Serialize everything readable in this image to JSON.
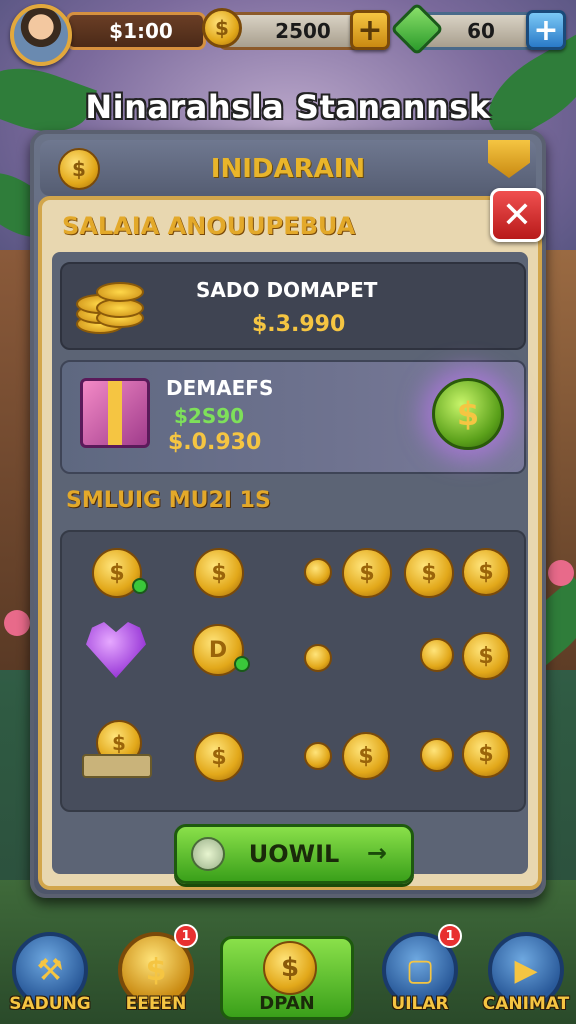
{
  "hud": {
    "money": "$1:00",
    "coins": "2500",
    "gems": "60",
    "coin_symbol": "$",
    "plus": "+"
  },
  "title": "Ninarahsla Stanannsk",
  "panel": {
    "header_title": "INIDARAIN",
    "coin_symbol": "$",
    "subtitle": "SALAIA ANOUUPEBUA",
    "close": "✕",
    "card1": {
      "title": "SADO DOMAPET",
      "price": "$.3.990"
    },
    "card2": {
      "title": "DEMAEFS",
      "green_price": "$2S90",
      "gold_price": "$.0.930",
      "coin_symbol": "$"
    },
    "section_label": "SMLUIG MU2I 1S",
    "grid_coin_symbol": "$",
    "grid_letter": "D",
    "button_label": "UOWIL",
    "button_arrow": "→"
  },
  "nav": {
    "items": [
      {
        "label": "SADUNG",
        "badge": ""
      },
      {
        "label": "EEEEN",
        "badge": "1"
      },
      {
        "label": "DPAN",
        "badge": ""
      },
      {
        "label": "UILAR",
        "badge": "1"
      },
      {
        "label": "CANIMAT",
        "badge": ""
      }
    ],
    "center_symbol": "$"
  },
  "colors": {
    "gold": "#f5c542",
    "green_button": "#3aa01a",
    "close_red": "#d02828",
    "panel_border": "#d2a64c"
  }
}
